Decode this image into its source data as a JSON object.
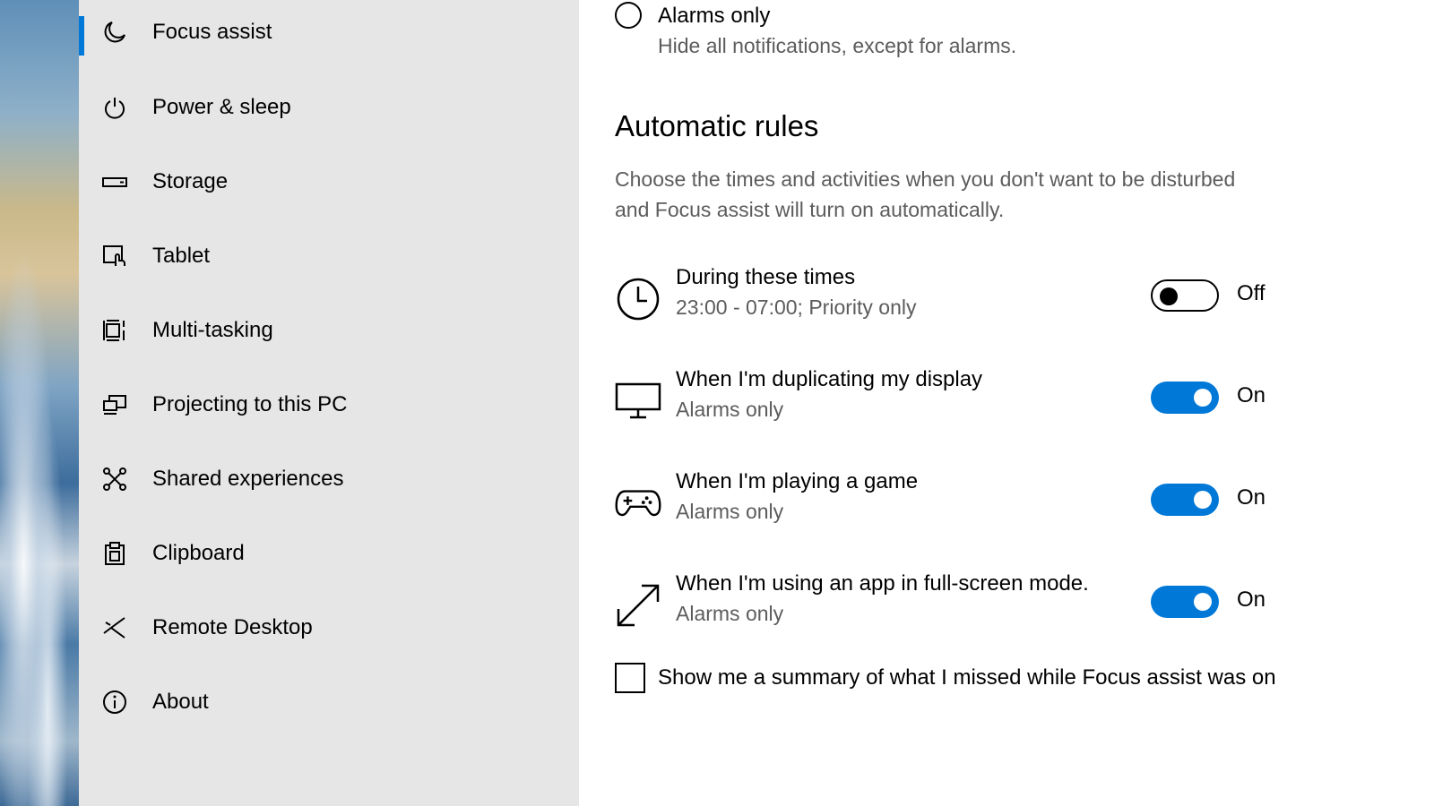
{
  "sidebar": {
    "items": [
      {
        "label": "Focus assist",
        "icon": "moon-icon",
        "active": true
      },
      {
        "label": "Power & sleep",
        "icon": "power-icon"
      },
      {
        "label": "Storage",
        "icon": "storage-icon"
      },
      {
        "label": "Tablet",
        "icon": "tablet-icon"
      },
      {
        "label": "Multi-tasking",
        "icon": "multitasking-icon"
      },
      {
        "label": "Projecting to this PC",
        "icon": "projecting-icon"
      },
      {
        "label": "Shared experiences",
        "icon": "shared-experiences-icon"
      },
      {
        "label": "Clipboard",
        "icon": "clipboard-icon"
      },
      {
        "label": "Remote Desktop",
        "icon": "remote-desktop-icon"
      },
      {
        "label": "About",
        "icon": "info-icon"
      }
    ]
  },
  "main": {
    "alarms_option": {
      "title": "Alarms only",
      "description": "Hide all notifications, except for alarms."
    },
    "automatic_rules": {
      "title": "Automatic rules",
      "description": "Choose the times and activities when you don't want to be disturbed and Focus assist will turn on automatically."
    },
    "rules": [
      {
        "title": "During these times",
        "subtitle": "23:00 - 07:00; Priority only",
        "state": "Off",
        "icon": "clock-icon"
      },
      {
        "title": "When I'm duplicating my display",
        "subtitle": "Alarms only",
        "state": "On",
        "icon": "monitor-icon"
      },
      {
        "title": "When I'm playing a game",
        "subtitle": "Alarms only",
        "state": "On",
        "icon": "gamepad-icon"
      },
      {
        "title": "When I'm using an app in full-screen mode.",
        "subtitle": "Alarms only",
        "state": "On",
        "icon": "fullscreen-arrow-icon"
      }
    ],
    "summary_checkbox": {
      "label": "Show me a summary of what I missed while Focus assist was on",
      "checked": false
    }
  },
  "colors": {
    "accent": "#0078d7",
    "sidebar_bg": "#e6e6e6",
    "secondary_text": "#5c5c5c"
  }
}
